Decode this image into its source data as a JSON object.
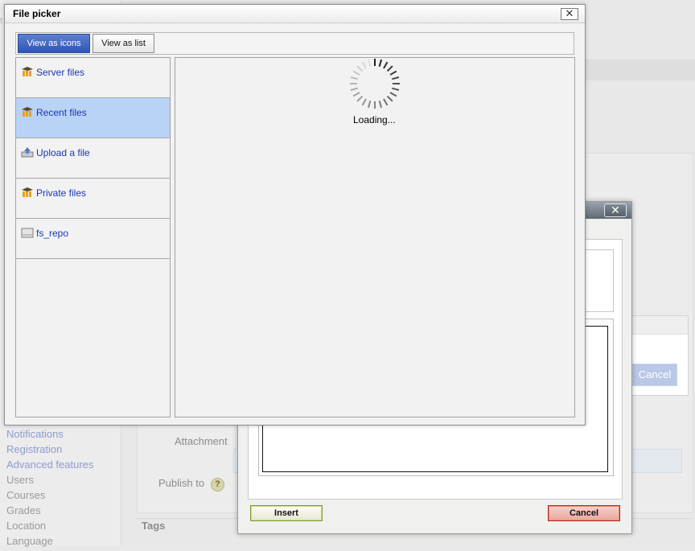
{
  "file_picker": {
    "title": "File picker",
    "close_symbol": "✕",
    "toolbar": {
      "view_as_icons": "View as icons",
      "view_as_list": "View as list"
    },
    "repositories": [
      {
        "label": "Server files",
        "icon": "moodle-icon"
      },
      {
        "label": "Recent files",
        "icon": "moodle-icon",
        "selected": true
      },
      {
        "label": "Upload a file",
        "icon": "upload-icon"
      },
      {
        "label": "Private files",
        "icon": "moodle-icon"
      },
      {
        "label": "fs_repo",
        "icon": "folder-icon"
      }
    ],
    "loading_text": "Loading..."
  },
  "background_page": {
    "nav_items": [
      "Notifications",
      "Registration",
      "Advanced features",
      "Users",
      "Courses",
      "Grades",
      "Location",
      "Language"
    ],
    "attachment_label": "Attachment",
    "publish_to_label": "Publish to",
    "help_symbol": "?",
    "tags_label": "Tags",
    "cancel_button": "Cancel"
  },
  "insert_dialog": {
    "close_symbol": "✕",
    "insert_button": "Insert",
    "cancel_button": "Cancel"
  },
  "colors": {
    "link": "#1a35b4",
    "selected_row": "#b8d3f5",
    "primary_button": "#2e56b8"
  }
}
